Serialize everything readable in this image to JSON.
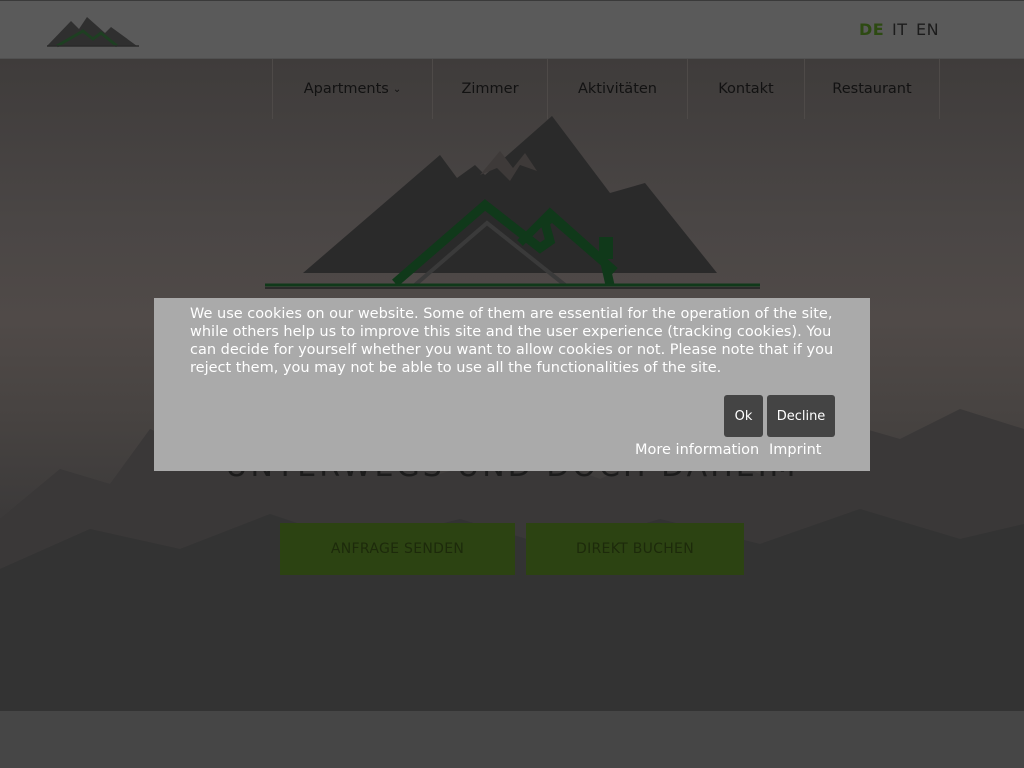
{
  "header": {
    "languages": [
      {
        "code": "DE",
        "active": true
      },
      {
        "code": "IT",
        "active": false
      },
      {
        "code": "EN",
        "active": false
      }
    ]
  },
  "nav": {
    "items": [
      {
        "label": "Apartments",
        "has_dropdown": true
      },
      {
        "label": "Zimmer"
      },
      {
        "label": "Aktivitäten"
      },
      {
        "label": "Kontakt"
      },
      {
        "label": "Restaurant"
      }
    ],
    "dropdown_icon": "chevron-down-icon"
  },
  "hero": {
    "tagline": "UNTERWEGS UND DOCH DAHEIM",
    "buttons": {
      "inquiry": "ANFRAGE SENDEN",
      "book": "DIREKT BUCHEN"
    }
  },
  "cookie_banner": {
    "text": "We use cookies on our website. Some of them are essential for the operation of the site, while others help us to improve this site and the user experience (tracking cookies). You can decide for yourself whether you want to allow cookies or not. Please note that if you reject them, you may not be able to use all the functionalities of the site.",
    "ok_label": "Ok",
    "decline_label": "Decline",
    "more_info_label": "More information",
    "imprint_label": "Imprint"
  },
  "colors": {
    "accent_green": "#2c4312",
    "header_bg": "#5a5a5a",
    "cookie_bg": "#aaaaaa",
    "cookie_button_bg": "#444444"
  }
}
